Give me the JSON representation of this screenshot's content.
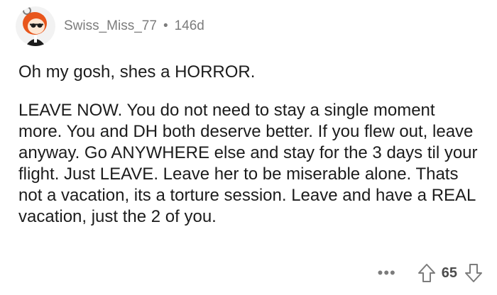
{
  "comment": {
    "username": "Swiss_Miss_77",
    "separator": "•",
    "age": "146d",
    "paragraphs": [
      "Oh my gosh, shes a HORROR.",
      "LEAVE NOW. You do not need to stay a single moment more. You and DH both deserve better. If you flew out, leave anyway. Go ANYWHERE else and stay for the 3 days til your flight. Just LEAVE. Leave her to be miserable alone. Thats not a vacation, its a torture session. Leave and have a REAL vacation, just the 2 of you."
    ],
    "actions": {
      "more": "•••",
      "score": "65"
    }
  },
  "icons": {
    "avatar": "user-avatar",
    "upvote": "upvote-arrow-icon",
    "downvote": "downvote-arrow-icon",
    "more": "more-options-icon"
  },
  "colors": {
    "meta": "#7c7c7c",
    "text": "#1c1c1c",
    "avatar_hair": "#e8561c"
  }
}
